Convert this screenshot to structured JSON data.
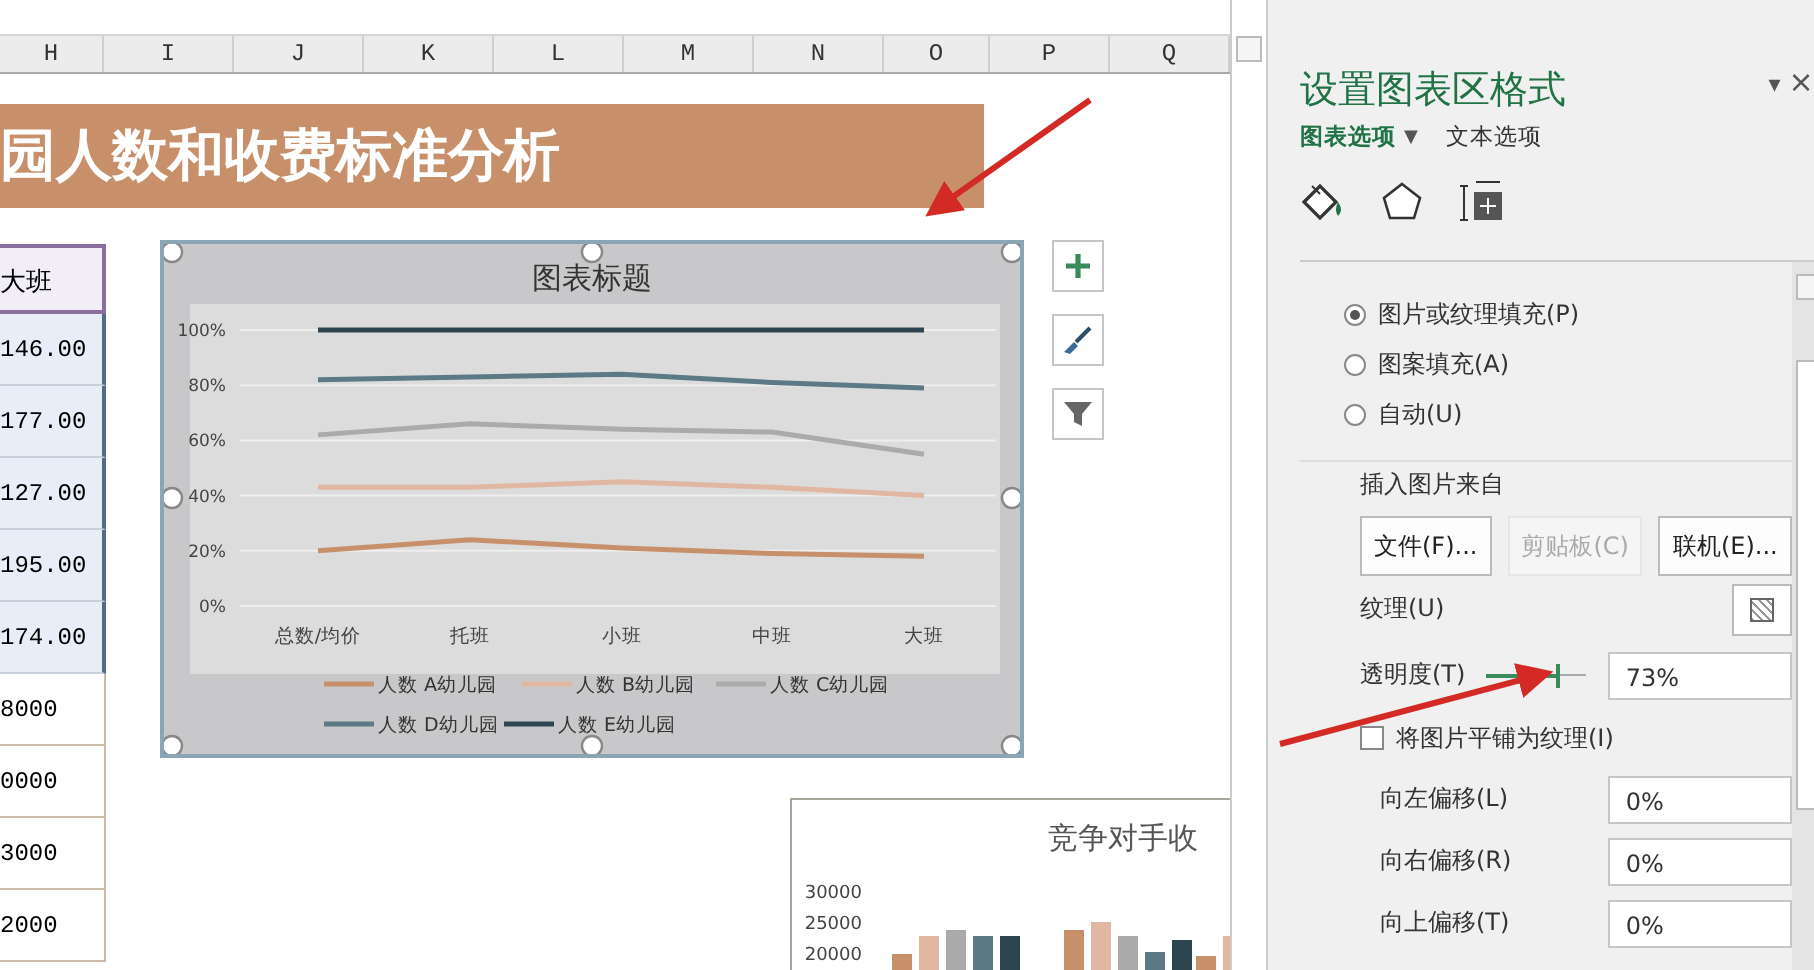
{
  "sheet": {
    "columns": [
      "H",
      "I",
      "J",
      "K",
      "L",
      "M",
      "N",
      "O",
      "P",
      "Q"
    ],
    "banner": "园人数和收费标准分析",
    "table": {
      "header": "大班",
      "cells": [
        {
          "text": "146.00",
          "selected": true
        },
        {
          "text": "177.00",
          "selected": true
        },
        {
          "text": "127.00",
          "selected": true
        },
        {
          "text": "195.00",
          "selected": true
        },
        {
          "text": "174.00",
          "selected": true
        },
        {
          "text": "8000",
          "selected": false
        },
        {
          "text": "0000",
          "selected": false
        },
        {
          "text": "3000",
          "selected": false
        },
        {
          "text": "2000",
          "selected": false
        }
      ]
    },
    "chart": {
      "selected": true,
      "chart_data": {
        "type": "line",
        "title": "图表标题",
        "categories": [
          "总数/均价",
          "托班",
          "小班",
          "中班",
          "大班"
        ],
        "series": [
          {
            "name": "人数 A幼儿园",
            "color": "#c8906a",
            "values": [
              0.2,
              0.24,
              0.21,
              0.19,
              0.18
            ]
          },
          {
            "name": "人数 B幼儿园",
            "color": "#e2b7a2",
            "values": [
              0.43,
              0.43,
              0.45,
              0.43,
              0.4
            ]
          },
          {
            "name": "人数 C幼儿园",
            "color": "#ababab",
            "values": [
              0.62,
              0.66,
              0.64,
              0.63,
              0.55
            ]
          },
          {
            "name": "人数 D幼儿园",
            "color": "#5b7a86",
            "values": [
              0.82,
              0.83,
              0.84,
              0.81,
              0.79
            ]
          },
          {
            "name": "人数 E幼儿园",
            "color": "#2c4550",
            "values": [
              1,
              1,
              1,
              1,
              1
            ]
          }
        ],
        "grid": true,
        "legend": true,
        "ylim": [
          0,
          1
        ],
        "yticks": [
          {
            "value": 0,
            "label": "0%"
          },
          {
            "value": 0.2,
            "label": "20%"
          },
          {
            "value": 0.4,
            "label": "40%"
          },
          {
            "value": 0.6,
            "label": "60%"
          },
          {
            "value": 0.8,
            "label": "80%"
          },
          {
            "value": 1,
            "label": "100%"
          }
        ]
      }
    },
    "chart2": {
      "title": "竞争对手收",
      "axis_labels": [
        "30000",
        "25000",
        "20000"
      ]
    }
  },
  "panel": {
    "title": "设置图表区格式",
    "menu_glyph": "▾",
    "close_glyph": "×",
    "tabs": [
      {
        "label": "图表选项",
        "selected": true
      },
      {
        "label": "文本选项",
        "selected": false
      }
    ],
    "tab_caret": "▼",
    "icons": [
      {
        "kind": "fill",
        "selected": true
      },
      {
        "kind": "effects",
        "selected": false
      },
      {
        "kind": "size",
        "selected": false
      }
    ],
    "fill_options": [
      {
        "label": "图片或纹理填充(P)",
        "selected": true
      },
      {
        "label": "图案填充(A)",
        "selected": false
      },
      {
        "label": "自动(U)",
        "selected": false
      }
    ],
    "insert_label": "插入图片来自",
    "insert_buttons": [
      {
        "label": "文件(F)...",
        "disabled": false
      },
      {
        "label": "剪贴板(C)",
        "disabled": true
      },
      {
        "label": "联机(E)...",
        "disabled": false
      }
    ],
    "texture_label": "纹理(U)",
    "transparency": {
      "label": "透明度(T)",
      "level": 0.73,
      "value": "73%"
    },
    "tile": {
      "label": "将图片平铺为纹理(I)",
      "checked": false
    },
    "offsets": [
      {
        "label": "向左偏移(L)",
        "value": "0%"
      },
      {
        "label": "向右偏移(R)",
        "value": "0%"
      },
      {
        "label": "向上偏移(T)",
        "value": "0%"
      }
    ]
  }
}
